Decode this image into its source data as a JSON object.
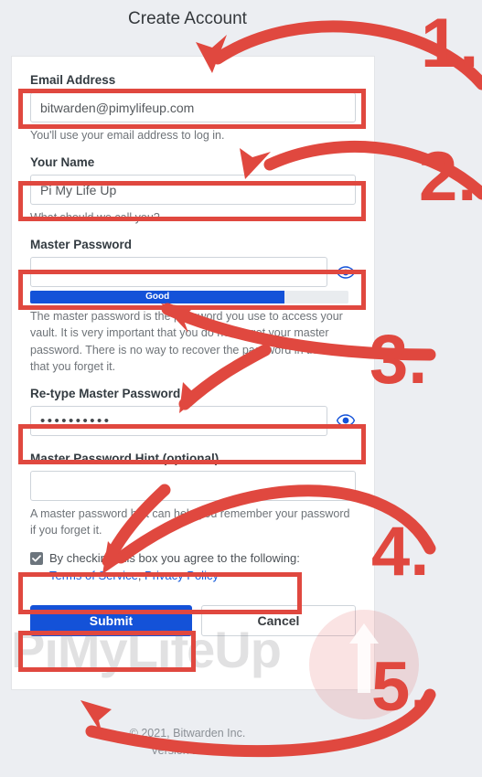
{
  "page": {
    "title": "Create Account",
    "background_color": "#eceef2",
    "card_background": "#ffffff",
    "accent_color": "#1452d8",
    "annotation_color": "#e0483f"
  },
  "form": {
    "email": {
      "label": "Email Address",
      "value": "bitwarden@pimylifeup.com",
      "placeholder": "",
      "help": "You'll use your email address to log in."
    },
    "name": {
      "label": "Your Name",
      "value": "Pi My Life Up",
      "placeholder": "",
      "help": "What should we call you?"
    },
    "master_password": {
      "label": "Master Password",
      "value": "••••••••••",
      "placeholder": "",
      "strength_label": "Good",
      "strength_percent": 80,
      "strength_color": "#1452d8",
      "help": "The master password is the password you use to access your vault. It is very important that you do not forget your master password. There is no way to recover the password in the event that you forget it."
    },
    "retype_password": {
      "label": "Re-type Master Password",
      "value": "••••••••••",
      "placeholder": ""
    },
    "password_hint": {
      "label": "Master Password Hint (optional)",
      "value": "",
      "placeholder": "",
      "help": "A master password hint can help you remember your password if you forget it."
    },
    "agreement": {
      "checked": true,
      "text": "By checking this box you agree to the following:",
      "terms_link": "Terms of Service",
      "separator": ", ",
      "privacy_link": "Privacy Policy"
    },
    "buttons": {
      "submit": "Submit",
      "cancel": "Cancel"
    }
  },
  "footer": {
    "copyright": "© 2021, Bitwarden Inc.",
    "version": "Version 2.18.1"
  },
  "watermark": {
    "text": "PiMyLifeUp"
  },
  "annotations": {
    "steps": [
      "1.",
      "2.",
      "3.",
      "4.",
      "5."
    ]
  }
}
